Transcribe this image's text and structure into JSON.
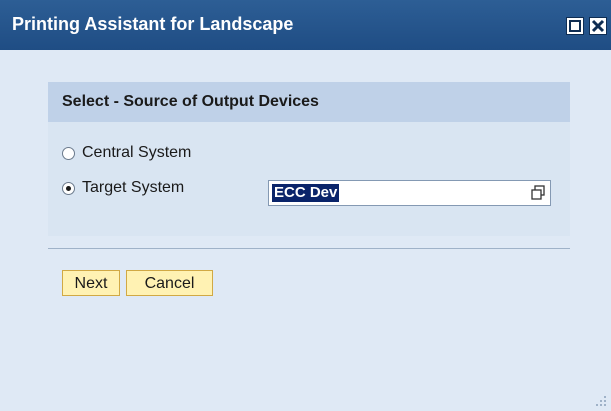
{
  "window": {
    "title": "Printing Assistant for Landscape"
  },
  "group": {
    "title": "Select - Source of Output Devices",
    "options": [
      {
        "label": "Central System",
        "checked": false
      },
      {
        "label": "Target System",
        "checked": true
      }
    ],
    "target_system_value": "ECC Dev"
  },
  "buttons": {
    "next": "Next",
    "cancel": "Cancel"
  },
  "colors": {
    "titlebar": "#1f4d84",
    "background": "#dfe9f5",
    "button_fill": "#fff2b3",
    "selection": "#0a246a"
  }
}
